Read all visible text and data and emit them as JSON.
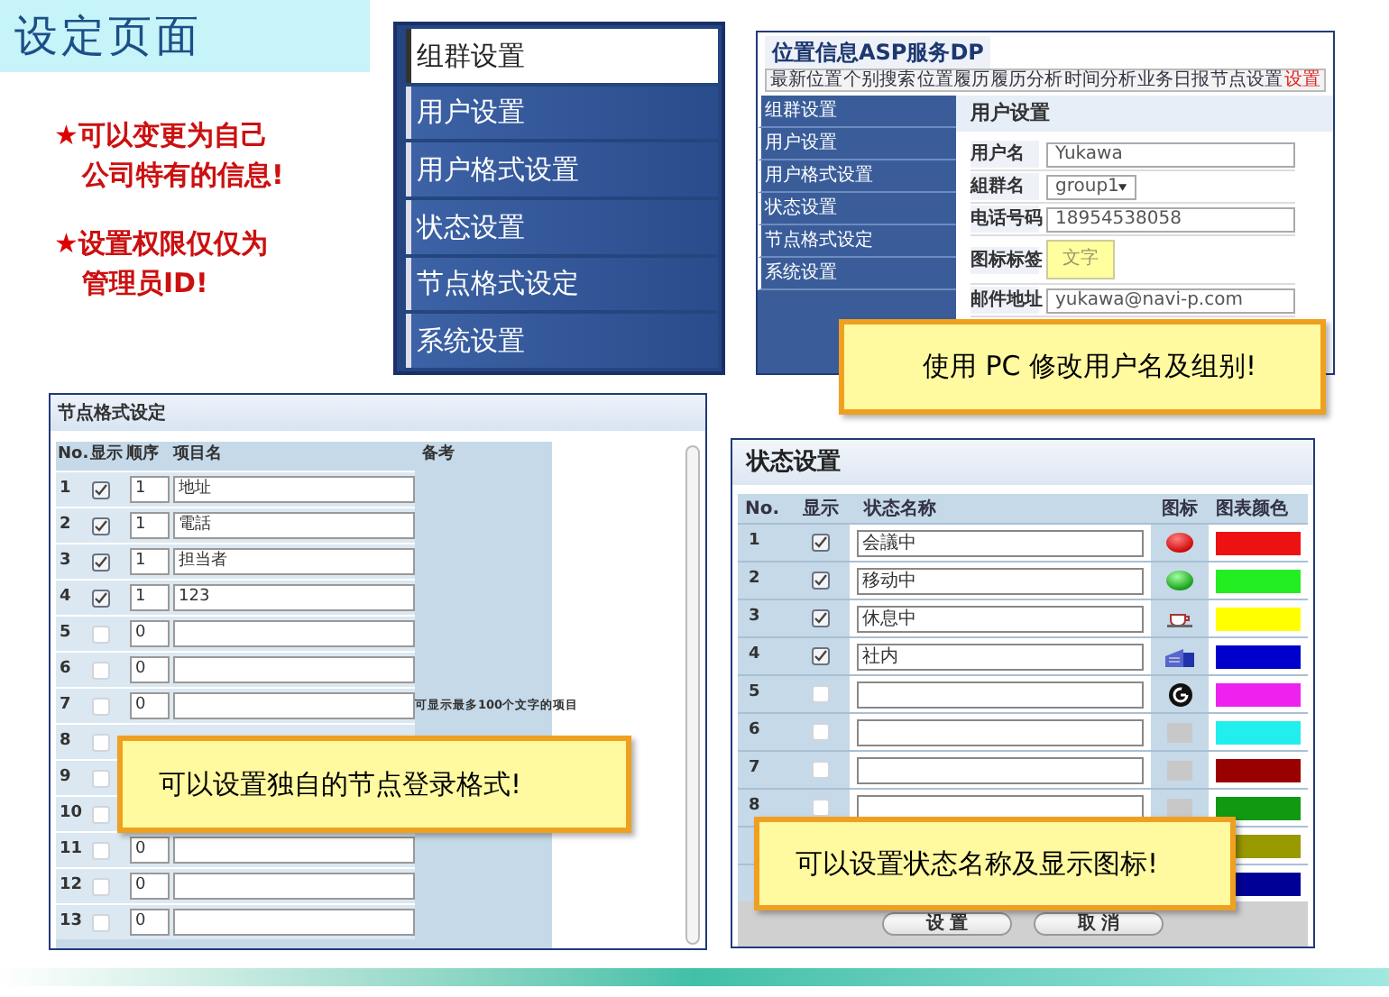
{
  "slide_title": "设定页面",
  "notes": [
    {
      "marker": "★",
      "lines": [
        "可以变更为自己",
        "公司特有的信息!"
      ]
    },
    {
      "marker": "★",
      "lines": [
        "设置权限仅仅为",
        "管理员ID!"
      ]
    }
  ],
  "menu": [
    {
      "label": "组群设置",
      "selected": true
    },
    {
      "label": "用户设置",
      "selected": false
    },
    {
      "label": "用户格式设置",
      "selected": false
    },
    {
      "label": "状态设置",
      "selected": false
    },
    {
      "label": "节点格式设定",
      "selected": false
    },
    {
      "label": "系统设置",
      "selected": false
    }
  ],
  "user_screen": {
    "app_title": "位置信息ASP服务DP",
    "nav": [
      {
        "label": "最新位置",
        "selected": false
      },
      {
        "label": "个别搜索",
        "selected": false
      },
      {
        "label": "位置履历",
        "selected": false
      },
      {
        "label": "履历分析",
        "selected": false
      },
      {
        "label": "时间分析",
        "selected": false
      },
      {
        "label": "业务日报",
        "selected": false
      },
      {
        "label": "节点设置",
        "selected": false
      },
      {
        "label": "设置",
        "selected": true
      }
    ],
    "sidebar": [
      "组群设置",
      "用户设置",
      "用户格式设置",
      "状态设置",
      "节点格式设定",
      "系统设置"
    ],
    "heading": "用户设置",
    "fields": [
      {
        "label": "用户名",
        "kind": "text",
        "value": "Yukawa"
      },
      {
        "label": "組群名",
        "kind": "select",
        "value": "group1"
      },
      {
        "label": "电话号码",
        "kind": "text",
        "value": "18954538058"
      },
      {
        "label": "图标标签",
        "kind": "tag",
        "value": "文字"
      },
      {
        "label": "邮件地址",
        "kind": "text",
        "value": "yukawa@navi-p.com"
      }
    ]
  },
  "callouts": [
    "使用 PC 修改用户名及组别!",
    "可以设置独自的节点登录格式!",
    "可以设置状态名称及显示图标!"
  ],
  "node_format": {
    "heading": "节点格式设定",
    "columns": [
      "No.",
      "显示",
      "顺序",
      "项目名",
      "备考"
    ],
    "remark": "可显示最多100个文字的项目",
    "rows": [
      {
        "no": "1",
        "checked": true,
        "order": "1",
        "name": "地址"
      },
      {
        "no": "2",
        "checked": true,
        "order": "1",
        "name": "電話"
      },
      {
        "no": "3",
        "checked": true,
        "order": "1",
        "name": "担当者"
      },
      {
        "no": "4",
        "checked": true,
        "order": "1",
        "name": "123"
      },
      {
        "no": "5",
        "checked": false,
        "order": "0"
      },
      {
        "no": "6",
        "checked": false,
        "order": "0"
      },
      {
        "no": "7",
        "checked": false,
        "order": "0"
      },
      {
        "no": "8",
        "checked": false
      },
      {
        "no": "9",
        "checked": false
      },
      {
        "no": "10",
        "checked": false
      },
      {
        "no": "11",
        "checked": false,
        "order": "0"
      },
      {
        "no": "12",
        "checked": false,
        "order": "0"
      },
      {
        "no": "13",
        "checked": false,
        "order": "0"
      }
    ]
  },
  "status": {
    "heading": "状态设置",
    "columns": [
      "No.",
      "显示",
      "状态名称",
      "图标",
      "图表颜色"
    ],
    "rows": [
      {
        "no": "1",
        "checked": true,
        "name": "会議中",
        "kind": "red-ball",
        "color": "#ee1111"
      },
      {
        "no": "2",
        "checked": true,
        "name": "移动中",
        "kind": "green-ball",
        "color": "#22ee22"
      },
      {
        "no": "3",
        "checked": true,
        "name": "休息中",
        "kind": "cup",
        "color": "#ffff00"
      },
      {
        "no": "4",
        "checked": true,
        "name": "社内",
        "kind": "building",
        "color": "#0000cc"
      },
      {
        "no": "5",
        "checked": false,
        "kind": "g-badge",
        "color": "#ee22ee"
      },
      {
        "no": "6",
        "checked": false,
        "kind": "blank",
        "color": "#22eeee"
      },
      {
        "no": "7",
        "checked": false,
        "kind": "blank",
        "color": "#990000"
      },
      {
        "no": "8",
        "checked": false,
        "kind": "blank",
        "color": "#119911"
      },
      {
        "kind": "hidden",
        "color": "#999900"
      },
      {
        "kind": "hidden",
        "color": "#000099"
      }
    ],
    "buttons": [
      "设 置",
      "取 消"
    ]
  }
}
